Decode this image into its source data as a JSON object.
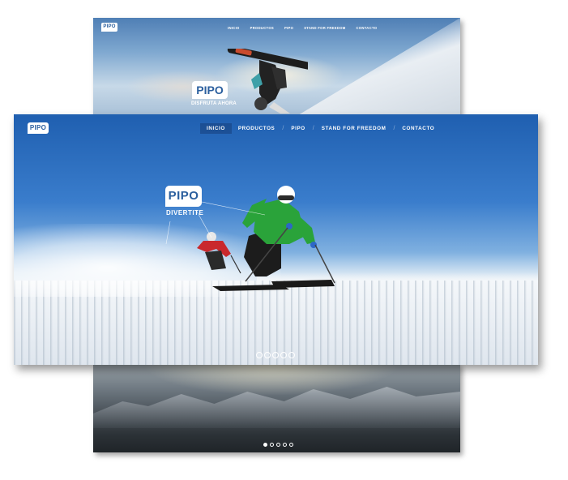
{
  "brand": {
    "logo_text": "PIPO"
  },
  "nav": {
    "items": [
      "INICIO",
      "PRODUCTOS",
      "PIPO",
      "STAND FOR FREEDOM",
      "CONTACTO"
    ],
    "active": "INICIO"
  },
  "top_slide": {
    "badge": "PIPO",
    "tagline": "DISFRUTA AHORA"
  },
  "main_slide": {
    "badge": "PIPO",
    "tagline": "DIVERTITE"
  },
  "slider": {
    "count": 5,
    "active_index": 0
  },
  "colors": {
    "brand_blue": "#2b5f9e",
    "sky": "#2e6fbf",
    "snow": "#eef2f6"
  }
}
